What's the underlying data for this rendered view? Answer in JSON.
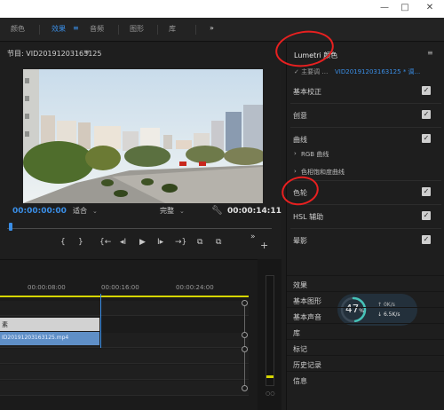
{
  "window": {
    "minimize": "—",
    "restore": "□",
    "close": "✕"
  },
  "workspaces": {
    "tabs": [
      "颜色",
      "效果",
      "音频",
      "图形",
      "库"
    ],
    "active_index": 1,
    "overflow": "»",
    "active_menu": "≡"
  },
  "program": {
    "title": "节目: VID20191203163125",
    "menu": "≡",
    "current_time": "00:00:00:00",
    "fit_label": "适合",
    "quality_label": "完整",
    "duration": "00:00:14:11",
    "transport": [
      "{",
      "}",
      "{←",
      "◂I",
      "▶",
      "I▸",
      "→}",
      "⧉",
      "⧉",
      "»",
      "+"
    ]
  },
  "timeline": {
    "ruler_labels": [
      "00:00:08:00",
      "00:00:16:00",
      "00:00:24:00"
    ],
    "video_clip": "素",
    "audio_clip": "ID20191203163125.mp4",
    "meter_label": "○○"
  },
  "lumetri": {
    "title": "Lumetri 颜色",
    "menu": "≡",
    "sub_label": "✓ 主要调 …",
    "sub_value": "VID20191203163125 * 调...",
    "sections": [
      {
        "label": "基本校正",
        "checked": true
      },
      {
        "label": "创意",
        "checked": true
      },
      {
        "label": "曲线",
        "checked": true
      },
      {
        "label": "RGB 曲线",
        "checked": false,
        "sub": true
      },
      {
        "label": "色相饱和度曲线",
        "checked": false,
        "sub": true
      },
      {
        "label": "色轮",
        "checked": true
      },
      {
        "label": "HSL 辅助",
        "checked": true
      },
      {
        "label": "晕影",
        "checked": true
      }
    ],
    "check_glyph": "✓"
  },
  "performance": {
    "percent_value": "47",
    "percent_unit": "%",
    "up": "0K/s",
    "down": "6.5K/s",
    "fraction": 0.47
  },
  "panels": [
    "效果",
    "基本图形",
    "基本声音",
    "库",
    "标记",
    "历史记录",
    "信息"
  ],
  "colors": {
    "accent": "#3a8ee6",
    "annotation": "#e82020",
    "workarea": "#d6d600"
  }
}
